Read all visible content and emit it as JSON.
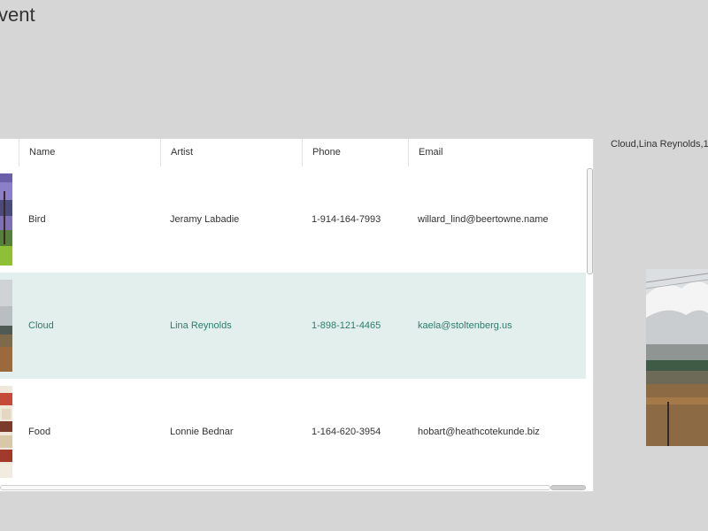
{
  "page": {
    "title": "vent"
  },
  "grid": {
    "columns": [
      "Name",
      "Artist",
      "Phone",
      "Email"
    ],
    "rows": [
      {
        "name": "Bird",
        "artist": "Jeramy Labadie",
        "phone": "1-914-164-7993",
        "email": "willard_lind@beertowne.name",
        "image": "bird-photo"
      },
      {
        "name": "Cloud",
        "artist": "Lina Reynolds",
        "phone": "1-898-121-4465",
        "email": "kaela@stoltenberg.us",
        "image": "cloud-photo",
        "selected": true
      },
      {
        "name": "Food",
        "artist": "Lonnie Bednar",
        "phone": "1-164-620-3954",
        "email": "hobart@heathcotekunde.biz",
        "image": "food-photo"
      }
    ]
  },
  "selection": {
    "summary": "Cloud,Lina Reynolds,1"
  },
  "colors": {
    "background": "#d6d6d6",
    "selected_row": "#e2efed",
    "selected_text": "#2e7d6b"
  }
}
